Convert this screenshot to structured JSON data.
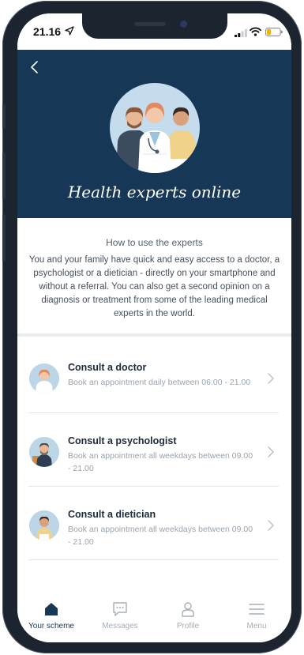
{
  "status_bar": {
    "time": "21.16"
  },
  "header": {
    "title": "Health experts online"
  },
  "intro": {
    "heading": "How to use the experts",
    "body": "You and your family have quick and easy access to a doctor, a psychologist or a dietician - directly on your smartphone and without a referral. You can also get a second opinion on a diagnosis or treatment from some of the leading medical experts in the world."
  },
  "experts": [
    {
      "title": "Consult a doctor",
      "subtitle": "Book an appointment daily between 06.00 - 21.00"
    },
    {
      "title": "Consult a psychologist",
      "subtitle": "Book an appointment all weekdays between 09.00 - 21.00"
    },
    {
      "title": "Consult a dietician",
      "subtitle": "Book an appointment all weekdays between 09.00 - 21.00"
    }
  ],
  "tabbar": {
    "tabs": [
      {
        "label": "Your scheme",
        "icon": "home-icon",
        "active": true
      },
      {
        "label": "Messages",
        "icon": "chat-icon",
        "active": false
      },
      {
        "label": "Profile",
        "icon": "person-icon",
        "active": false
      },
      {
        "label": "Menu",
        "icon": "menu-icon",
        "active": false
      }
    ]
  },
  "colors": {
    "hero_bg": "#163756",
    "accent": "#163756",
    "muted": "#a7aeb6"
  }
}
